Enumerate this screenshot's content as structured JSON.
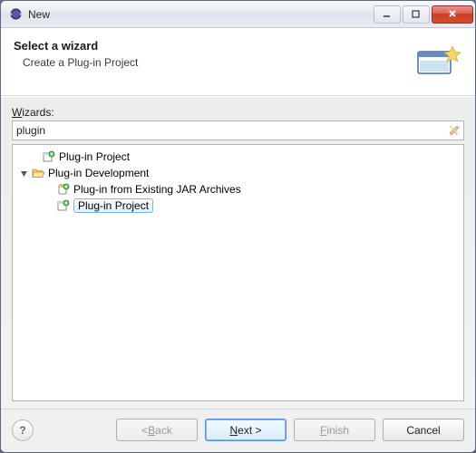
{
  "title": "New",
  "banner": {
    "heading": "Select a wizard",
    "description": "Create a Plug-in Project"
  },
  "filter": {
    "label_pre": "",
    "label_mn": "W",
    "label_post": "izards:",
    "value": "plugin"
  },
  "tree": {
    "items": [
      {
        "label": "Plug-in Project",
        "depth": 1,
        "expander": "none",
        "icon": "plugin-icon",
        "selected": false
      },
      {
        "label": "Plug-in Development",
        "depth": 0,
        "expander": "open",
        "icon": "folder-open-icon",
        "selected": false
      },
      {
        "label": "Plug-in from Existing JAR Archives",
        "depth": 2,
        "expander": "none",
        "icon": "jar-plugin-icon",
        "selected": false
      },
      {
        "label": "Plug-in Project",
        "depth": 2,
        "expander": "none",
        "icon": "plugin-icon",
        "selected": true
      }
    ]
  },
  "buttons": {
    "back_pre": "< ",
    "back_mn": "B",
    "back_post": "ack",
    "next_pre": "",
    "next_mn": "N",
    "next_post": "ext >",
    "finish_pre": "",
    "finish_mn": "F",
    "finish_post": "inish",
    "cancel": "Cancel"
  }
}
